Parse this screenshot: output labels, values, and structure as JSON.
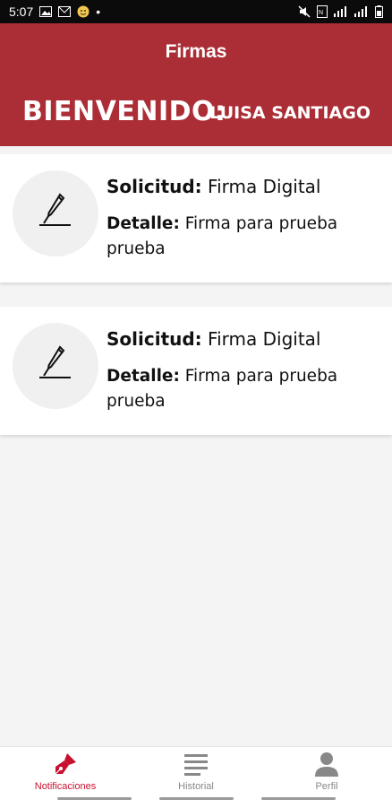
{
  "status_bar": {
    "time": "5:07",
    "dot": "•"
  },
  "header": {
    "title": "Firmas",
    "welcome": "BIENVENIDO:",
    "user_name": "LUISA SANTIAGO",
    "background_color": "#ab2e36"
  },
  "requests": [
    {
      "solicitud_label": "Solicitud:",
      "solicitud_value": "Firma Digital",
      "detalle_label": "Detalle:",
      "detalle_value": "Firma para prueba prueba",
      "icon": "fountain-pen-icon"
    },
    {
      "solicitud_label": "Solicitud:",
      "solicitud_value": "Firma Digital",
      "detalle_label": "Detalle:",
      "detalle_value": "Firma para prueba prueba",
      "icon": "fountain-pen-icon"
    }
  ],
  "bottom_nav": {
    "items": [
      {
        "label": "Notificaciones",
        "icon": "pen-nib-icon",
        "active": true
      },
      {
        "label": "Historial",
        "icon": "list-lines-icon",
        "active": false
      },
      {
        "label": "Perfil",
        "icon": "person-icon",
        "active": false
      }
    ],
    "active_color": "#c8102e",
    "inactive_color": "#888888"
  }
}
